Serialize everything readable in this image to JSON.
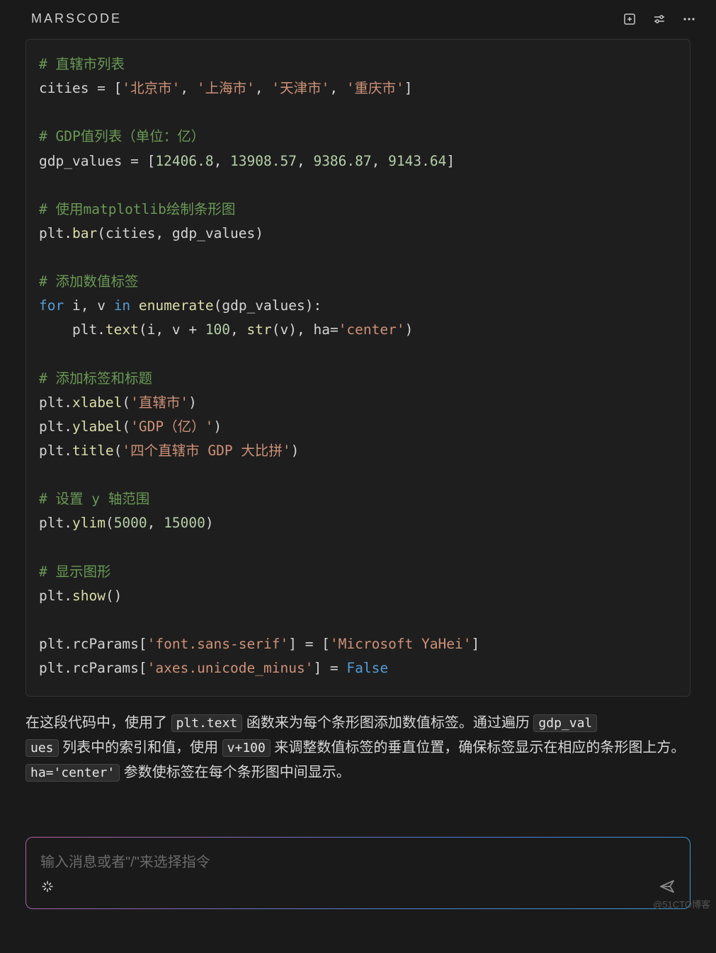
{
  "header": {
    "title": "MARSCODE"
  },
  "code": {
    "c1": "# 直辖市列表",
    "l1a": "cities = [",
    "l1s1": "'北京市'",
    "l1s2": "'上海市'",
    "l1s3": "'天津市'",
    "l1s4": "'重庆市'",
    "l1z": "]",
    "c2": "# GDP值列表（单位：亿）",
    "l2a": "gdp_values = [",
    "l2n1": "12406.8",
    "l2n2": "13908.57",
    "l2n3": "9386.87",
    "l2n4": "9143.64",
    "l2z": "]",
    "c3": "# 使用matplotlib绘制条形图",
    "l3a": "plt.",
    "l3f": "bar",
    "l3b": "(cities, gdp_values)",
    "c4": "# 添加数值标签",
    "l4a": "for",
    "l4b": " i, v ",
    "l4c": "in",
    "l4d": " ",
    "l4e": "enumerate",
    "l4f": "(gdp_values):",
    "l5a": "    plt.",
    "l5f": "text",
    "l5b": "(i, v + ",
    "l5n": "100",
    "l5c": ", ",
    "l5g": "str",
    "l5d": "(v), ha=",
    "l5s": "'center'",
    "l5e": ")",
    "c5": "# 添加标签和标题",
    "l6a": "plt.",
    "l6f": "xlabel",
    "l6b": "(",
    "l6s": "'直辖市'",
    "l6c": ")",
    "l7a": "plt.",
    "l7f": "ylabel",
    "l7b": "(",
    "l7s": "'GDP（亿）'",
    "l7c": ")",
    "l8a": "plt.",
    "l8f": "title",
    "l8b": "(",
    "l8s": "'四个直辖市 GDP 大比拼'",
    "l8c": ")",
    "c6": "# 设置 y 轴范围",
    "l9a": "plt.",
    "l9f": "ylim",
    "l9b": "(",
    "l9n1": "5000",
    "l9c": ", ",
    "l9n2": "15000",
    "l9d": ")",
    "c7": "# 显示图形",
    "l10a": "plt.",
    "l10f": "show",
    "l10b": "()",
    "l11a": "plt.rcParams[",
    "l11s1": "'font.sans-serif'",
    "l11b": "] = [",
    "l11s2": "'Microsoft YaHei'",
    "l11c": "]",
    "l12a": "plt.rcParams[",
    "l12s": "'axes.unicode_minus'",
    "l12b": "] = ",
    "l12k": "False"
  },
  "explain": {
    "t1": "在这段代码中，使用了 ",
    "chip1": "plt.text",
    "t2": " 函数来为每个条形图添加数值标签。通过遍历 ",
    "chip2": "gdp_val",
    "chip2b": "ues",
    "t3": " 列表中的索引和值，使用 ",
    "chip3": "v+100",
    "t4": " 来调整数值标签的垂直位置，确保标签显示在相应的条形图上方。",
    "chip4": "ha='center'",
    "t5": " 参数使标签在每个条形图中间显示。"
  },
  "input": {
    "placeholder": "输入消息或者\"/\"来选择指令"
  },
  "watermark": "@51CTO博客",
  "chart_data": {
    "type": "bar",
    "categories": [
      "北京市",
      "上海市",
      "天津市",
      "重庆市"
    ],
    "values": [
      12406.8,
      13908.57,
      9386.87,
      9143.64
    ],
    "title": "四个直辖市 GDP 大比拼",
    "xlabel": "直辖市",
    "ylabel": "GDP（亿）",
    "ylim": [
      5000,
      15000
    ]
  }
}
